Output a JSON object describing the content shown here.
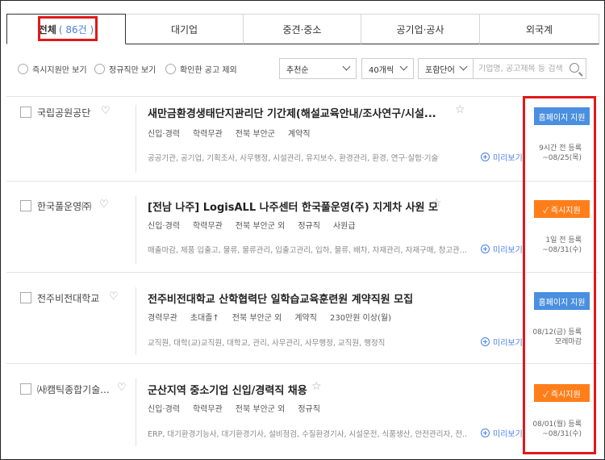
{
  "tabs": [
    {
      "label": "전체",
      "count": "( 86건 )",
      "active": true
    },
    {
      "label": "대기업"
    },
    {
      "label": "중견·중소"
    },
    {
      "label": "공기업·공사"
    },
    {
      "label": "외국계"
    }
  ],
  "filters": {
    "instant_only": "즉시지원만 보기",
    "regular_only": "정규직만 보기",
    "exclude_viewed": "확인한 공고 제외",
    "sort": "추천순",
    "per_page": "40개씩",
    "keyword_mode": "포함단어",
    "search_placeholder": "기업명, 공고제목 등 검색"
  },
  "listings": [
    {
      "company": "국립공원공단",
      "title": "새만금환경생태단지관리단 기간제(해설교육안내/조사연구/시설...",
      "meta": [
        "신입·경력",
        "학력무관",
        "전북 부안군",
        "계약직"
      ],
      "tags": "공공기관, 공기업, 기획조사, 사무행정, 시설관리, 유지보수, 환경관리, 환경, 연구·실험·기술",
      "preview": "미리보기",
      "button": "홈페이지 지원",
      "button_type": "blue",
      "posted": "9시간 전 등록",
      "deadline": "~08/25(목)"
    },
    {
      "company": "한국풀운영㈜",
      "title": "[전남 나주] LogisALL 나주센터 한국풀운영(주) 지게차 사원 모집",
      "meta": [
        "신입·경력",
        "학력무관",
        "전북 부안군 외",
        "정규직",
        "사원급"
      ],
      "tags": "매출마감, 제품 입출고, 물류, 물류관리, 입출고관리, 입하, 물류, 배차, 자재관리, 자재구매, 창고관...",
      "preview": "미리보기",
      "button": "✓ 즉시지원",
      "button_type": "orange",
      "posted": "1일 전 등록",
      "deadline": "~08/31(수)"
    },
    {
      "company": "전주비전대학교",
      "title": "전주비전대학교 산학협력단 일학습교육훈련원 계약직원 모집",
      "meta": [
        "경력무관",
        "초대졸↑",
        "전북 부안군 외",
        "계약직",
        "230만원 이상(월)"
      ],
      "tags": "교직원, 대학(교)교직원, 대학교, 관리, 사무관리, 사무행정, 교직원, 행정직",
      "preview": "미리보기",
      "button": "홈페이지 지원",
      "button_type": "blue",
      "posted": "08/12(금) 등록",
      "deadline": "모레마감"
    },
    {
      "company": "㈔캠틱종합기술...",
      "title": "군산지역 중소기업 신입/경력직 채용",
      "meta": [
        "신입·경력",
        "학력무관",
        "전북 부안군 외",
        "정규직"
      ],
      "tags": "ERP, 대기환경기능사, 대기환경기사, 설비점검, 수질환경기사, 시설운전, 식품생산, 안전관리자, 전...",
      "preview": "미리보기",
      "button": "✓ 즉시지원",
      "button_type": "orange",
      "posted": "08/01(월) 등록",
      "deadline": "~08/31(수)"
    }
  ]
}
